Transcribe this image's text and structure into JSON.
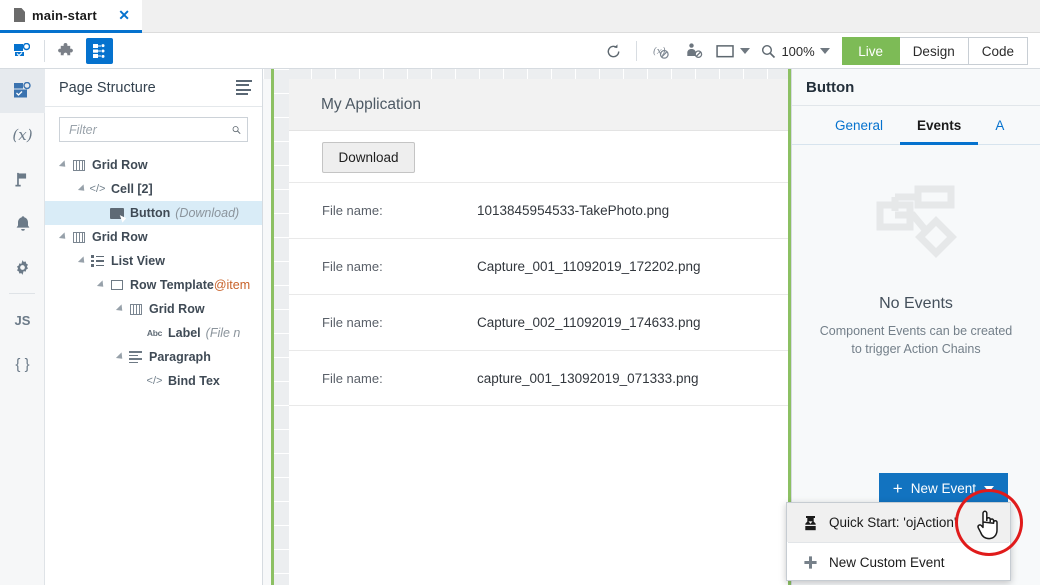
{
  "tab": {
    "label": "main-start",
    "close": "✕",
    "icon": "document-icon"
  },
  "toolbar": {
    "refresh_icon": "refresh-icon",
    "variables_icon": "variables-disabled-icon",
    "user_icon": "user-settings-icon",
    "device_icon": "device-preview-icon",
    "search_icon": "search-icon",
    "zoom_level": "100%",
    "modes": [
      {
        "label": "Live",
        "active": true
      },
      {
        "label": "Design",
        "active": false
      },
      {
        "label": "Code",
        "active": false
      }
    ],
    "left_icons": [
      {
        "name": "page-designer-icon",
        "active": false
      },
      {
        "name": "components-puzzle-icon",
        "active": false
      },
      {
        "name": "page-structure-icon",
        "active": true
      }
    ]
  },
  "rail": {
    "items": [
      {
        "name": "page-designer-icon",
        "glyph": "",
        "selected": true
      },
      {
        "name": "variables-icon",
        "glyph": "(x)",
        "selected": false
      },
      {
        "name": "flow-icon",
        "glyph": "",
        "selected": false
      },
      {
        "name": "events-bell-icon",
        "glyph": "",
        "selected": false
      },
      {
        "name": "settings-gear-icon",
        "glyph": "",
        "selected": false
      },
      {
        "name": "javascript-icon",
        "glyph": "JS",
        "selected": false
      },
      {
        "name": "json-icon",
        "glyph": "{ }",
        "selected": false
      }
    ]
  },
  "structure": {
    "title": "Page Structure",
    "filter_placeholder": "Filter",
    "filter_value": "",
    "tree": [
      {
        "indent": 0,
        "twisty": true,
        "icon": "grid-row-icon",
        "label": "Grid Row",
        "meta": "",
        "meta_style": "italic",
        "selected": false
      },
      {
        "indent": 1,
        "twisty": true,
        "icon": "code-cell-icon",
        "label": "Cell [2]",
        "meta": "",
        "meta_style": "italic",
        "selected": false
      },
      {
        "indent": 2,
        "twisty": false,
        "icon": "button-icon",
        "label": "Button",
        "meta": "(Download)",
        "meta_style": "italic",
        "selected": true
      },
      {
        "indent": 0,
        "twisty": true,
        "icon": "grid-row-icon",
        "label": "Grid Row",
        "meta": "",
        "meta_style": "italic",
        "selected": false
      },
      {
        "indent": 1,
        "twisty": true,
        "icon": "list-view-icon",
        "label": "List View",
        "meta": "",
        "meta_style": "italic",
        "selected": false
      },
      {
        "indent": 2,
        "twisty": true,
        "icon": "row-template-icon",
        "label": "Row Template",
        "meta": "@item",
        "meta_style": "orange",
        "selected": false
      },
      {
        "indent": 3,
        "twisty": true,
        "icon": "grid-row-icon",
        "label": "Grid Row",
        "meta": "",
        "meta_style": "italic",
        "selected": false
      },
      {
        "indent": 4,
        "twisty": false,
        "icon": "label-abc-icon",
        "label": "Label",
        "meta": "(File n",
        "meta_style": "italic",
        "selected": false
      },
      {
        "indent": 3,
        "twisty": true,
        "icon": "paragraph-icon",
        "label": "Paragraph",
        "meta": "",
        "meta_style": "italic",
        "selected": false
      },
      {
        "indent": 4,
        "twisty": false,
        "icon": "code-cell-icon",
        "label": "Bind Tex",
        "meta": "",
        "meta_style": "italic",
        "selected": false
      }
    ]
  },
  "canvas": {
    "app_title": "My Application",
    "download_button": "Download",
    "file_label": "File name:",
    "files": [
      {
        "label": "File name:",
        "value": "1013845954533-TakePhoto.png"
      },
      {
        "label": "File name:",
        "value": "Capture_001_11092019_172202.png"
      },
      {
        "label": "File name:",
        "value": "Capture_002_11092019_174633.png"
      },
      {
        "label": "File name:",
        "value": "capture_001_13092019_071333.png"
      }
    ]
  },
  "properties": {
    "title": "Button",
    "tabs": [
      {
        "label": "General",
        "active": false
      },
      {
        "label": "Events",
        "active": true
      },
      {
        "label": "A",
        "active": false
      }
    ],
    "empty_title": "No Events",
    "empty_desc_line1": "Component Events can be created",
    "empty_desc_line2": "to trigger Action Chains",
    "new_event_label": "New Event",
    "new_event_plus": "+"
  },
  "dropdown": {
    "items": [
      {
        "label": "Quick Start: 'ojAction'",
        "icon": "quick-start-icon",
        "hover": true
      },
      {
        "label": "New Custom Event",
        "icon": "plus-icon",
        "hover": false
      }
    ]
  },
  "colors": {
    "accent_blue": "#0572ce",
    "button_blue": "#1273c0",
    "live_green": "#7dbb56",
    "canvas_border_green": "#8cc063",
    "annotation_red": "#e01b1b",
    "selection_blue": "#d9ecf7",
    "tree_orange": "#c8622a"
  }
}
